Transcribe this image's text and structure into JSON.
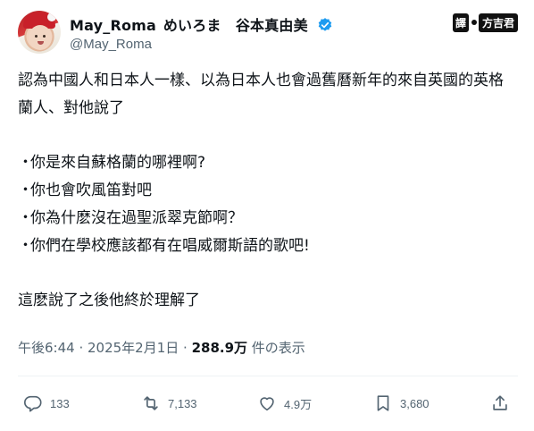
{
  "author": {
    "display_name": "May_Roma",
    "display_name_jp": "めいろま　谷本真由美",
    "handle": "@May_Roma",
    "verified": true
  },
  "logo": {
    "char1": "譯",
    "text": "方吉君"
  },
  "tweet": {
    "paragraph1": "認為中國人和日本人一樣、以為日本人也會過舊曆新年的來自英國的英格蘭人、對他說了",
    "bullets": [
      "你是來自蘇格蘭的哪裡啊?",
      "你也會吹風笛對吧",
      "你為什麽沒在過聖派翠克節啊？",
      "你們在學校應該都有在唱威爾斯語的歌吧!"
    ],
    "bullet_char": "・",
    "paragraph2": "這麽說了之後他終於理解了"
  },
  "meta": {
    "time": "午後6:44",
    "sep": " · ",
    "date": "2025年2月1日",
    "views": "288.9万",
    "views_suffix": " 件の表示"
  },
  "actions": {
    "replies": "133",
    "retweets": "7,133",
    "likes": "4.9万",
    "bookmarks": "3,680"
  },
  "colors": {
    "text": "#0f1419",
    "secondary": "#536471",
    "verified": "#1d9bf0",
    "divider": "#eff3f4"
  }
}
